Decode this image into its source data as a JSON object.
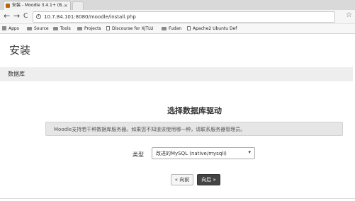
{
  "browser": {
    "tab_title": "安装 - Moodle 3.4.1+ (B...",
    "tab_close": "×",
    "url": "10.7.84.101:8080/moodle/install.php",
    "nav": {
      "back": "←",
      "forward": "→",
      "reload": "C",
      "home": "⌂",
      "star": "☆",
      "info": "i"
    },
    "bookmarks": [
      "Apps",
      "Source",
      "Tools",
      "Projects",
      "Discourse for XJTLU",
      "Fudan",
      "Apache2 Ubuntu Def"
    ]
  },
  "page": {
    "title": "安装",
    "breadcrumb": "数据库",
    "heading": "选择数据库驱动",
    "info": "Moodle支持若干种数据库服务器。如果您不知道该使用哪一种，请联系服务器管理员。",
    "type_label": "类型",
    "selected_driver": "改进的MySQL (native/mysqli)",
    "select_caret": "▾",
    "prev_button": "« 向前",
    "next_button": "向后 »"
  }
}
